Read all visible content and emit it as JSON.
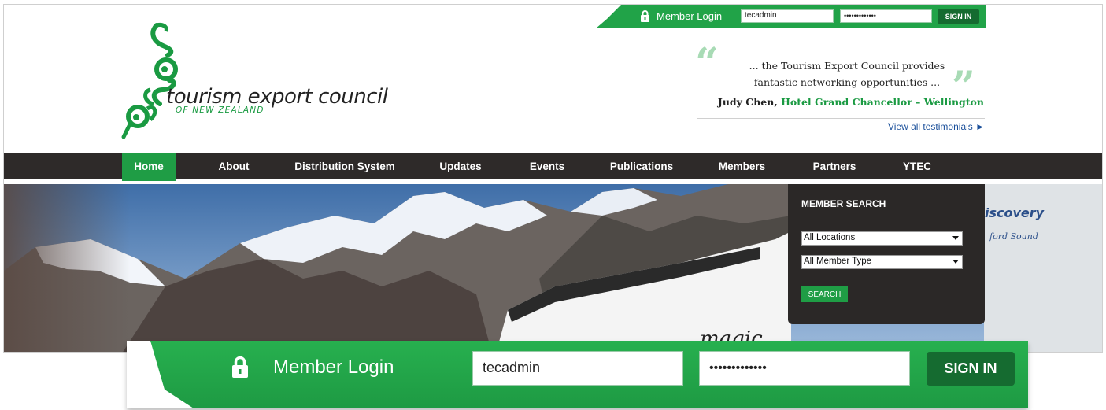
{
  "login": {
    "title": "Member Login",
    "username": "tecadmin",
    "password_mask": "•••••••••••••",
    "signin_label": "SIGN IN",
    "lock_icon": "lock-icon"
  },
  "logo": {
    "title": "tourism export council",
    "subtitle": "OF NEW ZEALAND"
  },
  "testimonial": {
    "open_quote": "“",
    "close_quote": "”",
    "text": "... the Tourism Export Council provides fantastic networking opportunities ...",
    "author_name": "Judy Chen,",
    "author_org": "Hotel Grand Chancellor – Wellington",
    "view_all": "View all testimonials ►"
  },
  "nav": {
    "items": [
      {
        "label": "Home",
        "active": true
      },
      {
        "label": "About"
      },
      {
        "label": "Distribution System"
      },
      {
        "label": "Updates"
      },
      {
        "label": "Events"
      },
      {
        "label": "Publications"
      },
      {
        "label": "Members"
      },
      {
        "label": "Partners"
      },
      {
        "label": "YTEC"
      }
    ]
  },
  "member_search": {
    "title": "MEMBER SEARCH",
    "location_value": "All Locations",
    "type_value": "All Member Type",
    "search_label": "SEARCH"
  },
  "hero": {
    "bus_text": "magic",
    "bus_brand": "iscovery",
    "bus_route": "ford Sound"
  },
  "colors": {
    "brand_green": "#1f9d45",
    "dark_green": "#156b30",
    "nav_bg": "#2e2a29",
    "link_blue": "#1a4f9a"
  }
}
